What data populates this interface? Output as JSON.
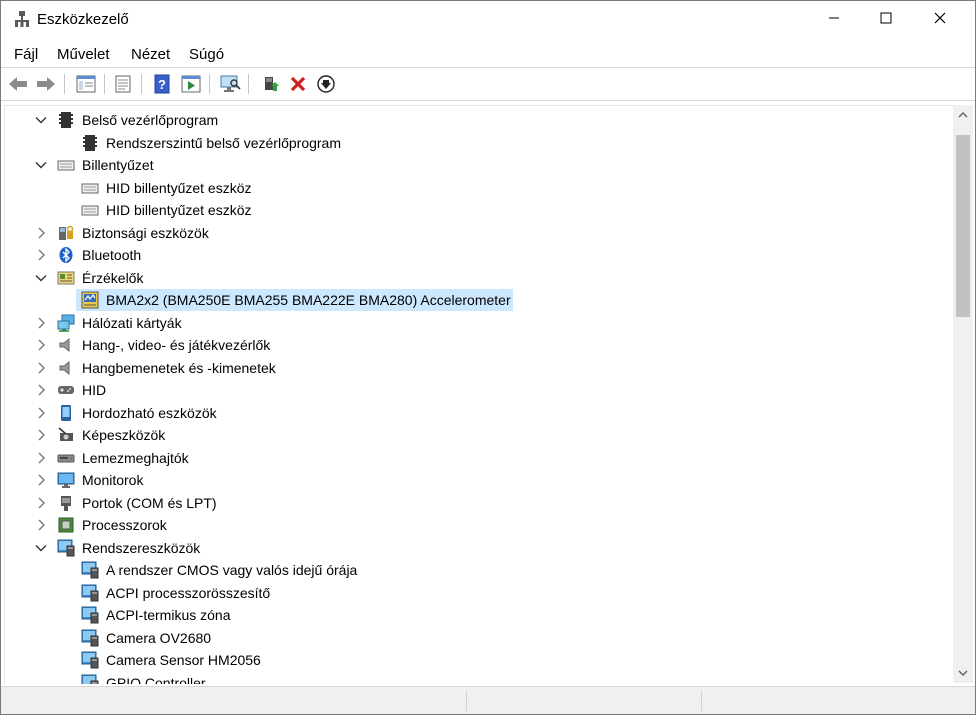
{
  "window": {
    "title": "Eszközkezelő"
  },
  "menu": [
    "Fájl",
    "Művelet",
    "Nézet",
    "Súgó"
  ],
  "toolbar": {
    "buttons": [
      "back-icon",
      "forward-icon",
      "properties-window-icon",
      "properties-sheet-icon",
      "help-icon",
      "run-icon",
      "scan-monitor-icon",
      "update-driver-icon",
      "uninstall-icon",
      "disable-icon"
    ]
  },
  "tree": [
    {
      "label": "Belső vezérlőprogram",
      "expanded": true,
      "level": 0,
      "icon": "firmware-icon"
    },
    {
      "label": "Rendszerszintű belső vezérlőprogram",
      "level": 1,
      "icon": "firmware-icon"
    },
    {
      "label": "Billentyűzet",
      "expanded": true,
      "level": 0,
      "icon": "keyboard-icon"
    },
    {
      "label": "HID billentyűzet eszköz",
      "level": 1,
      "icon": "keyboard-icon"
    },
    {
      "label": "HID billentyűzet eszköz",
      "level": 1,
      "icon": "keyboard-icon"
    },
    {
      "label": "Biztonsági eszközök",
      "expanded": false,
      "level": 0,
      "icon": "security-icon"
    },
    {
      "label": "Bluetooth",
      "expanded": false,
      "level": 0,
      "icon": "bluetooth-icon"
    },
    {
      "label": "Érzékelők",
      "expanded": true,
      "level": 0,
      "icon": "sensor-icon"
    },
    {
      "label": "BMA2x2 (BMA250E BMA255 BMA222E BMA280) Accelerometer",
      "level": 1,
      "icon": "accelerometer-icon",
      "selected": true
    },
    {
      "label": "Hálózati kártyák",
      "expanded": false,
      "level": 0,
      "icon": "network-icon"
    },
    {
      "label": "Hang-, video- és játékvezérlők",
      "expanded": false,
      "level": 0,
      "icon": "speaker-icon"
    },
    {
      "label": "Hangbemenetek és -kimenetek",
      "expanded": false,
      "level": 0,
      "icon": "speaker-icon"
    },
    {
      "label": "HID",
      "expanded": false,
      "level": 0,
      "icon": "hid-icon"
    },
    {
      "label": "Hordozható eszközök",
      "expanded": false,
      "level": 0,
      "icon": "portable-device-icon"
    },
    {
      "label": "Képeszközök",
      "expanded": false,
      "level": 0,
      "icon": "camera-device-icon"
    },
    {
      "label": "Lemezmeghajtók",
      "expanded": false,
      "level": 0,
      "icon": "disk-drive-icon"
    },
    {
      "label": "Monitorok",
      "expanded": false,
      "level": 0,
      "icon": "monitor-icon"
    },
    {
      "label": "Portok (COM és LPT)",
      "expanded": false,
      "level": 0,
      "icon": "port-icon"
    },
    {
      "label": "Processzorok",
      "expanded": false,
      "level": 0,
      "icon": "processor-icon"
    },
    {
      "label": "Rendszereszközök",
      "expanded": true,
      "level": 0,
      "icon": "system-device-icon"
    },
    {
      "label": "A rendszer CMOS vagy valós idejű órája",
      "level": 1,
      "icon": "system-device-icon"
    },
    {
      "label": "ACPI processzorösszesítő",
      "level": 1,
      "icon": "system-device-icon"
    },
    {
      "label": "ACPI-termikus zóna",
      "level": 1,
      "icon": "system-device-icon"
    },
    {
      "label": "Camera OV2680",
      "level": 1,
      "icon": "system-device-icon"
    },
    {
      "label": "Camera Sensor HM2056",
      "level": 1,
      "icon": "system-device-icon"
    },
    {
      "label": "GPIO Controller",
      "level": 1,
      "icon": "system-device-icon"
    }
  ]
}
